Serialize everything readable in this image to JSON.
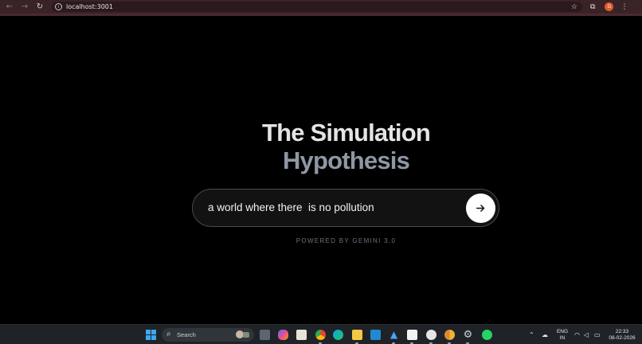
{
  "browser": {
    "url": "localhost:3001",
    "profile_initial": "G",
    "colors": {
      "chrome": "#3a2327",
      "profile": "#e05a2a"
    }
  },
  "hero": {
    "title_line1": "The Simulation",
    "title_line2": "Hypothesis"
  },
  "prompt": {
    "value": "a world where there  is no pollution",
    "submit_icon": "arrow-right-icon"
  },
  "footer": {
    "powered_by": "POWERED BY GEMINI 3.0"
  },
  "taskbar": {
    "search_label": "Search",
    "lang_line1": "ENG",
    "lang_line2": "IN",
    "time": "22:33",
    "date": "08-02-2026",
    "apps": [
      "widgets-icon",
      "file-explorer-icon",
      "copilot-icon",
      "store-icon",
      "chrome-icon",
      "edge-icon",
      "folder-icon",
      "vscode-icon",
      "app-icon",
      "notion-icon",
      "discord-icon",
      "chrome-canary-icon",
      "settings-icon",
      "whatsapp-icon"
    ]
  }
}
